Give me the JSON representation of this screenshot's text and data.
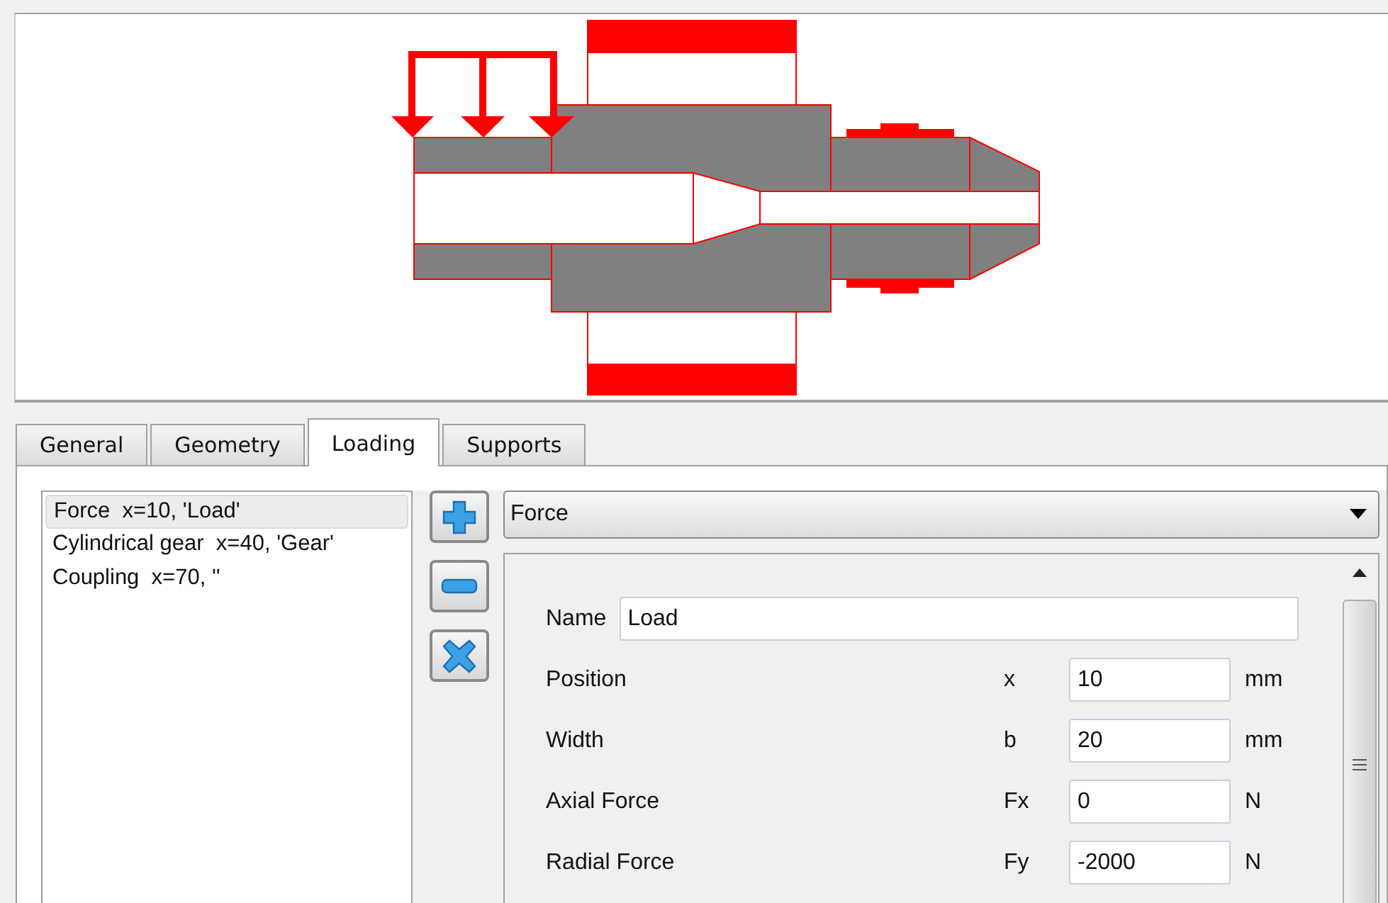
{
  "tabs": [
    {
      "label": "General",
      "selected": false
    },
    {
      "label": "Geometry",
      "selected": false
    },
    {
      "label": "Loading",
      "selected": true
    },
    {
      "label": "Supports",
      "selected": false
    }
  ],
  "elements": [
    {
      "label": "Force  x=10, 'Load'",
      "selected": true
    },
    {
      "label": "Cylindrical gear  x=40, 'Gear'",
      "selected": false
    },
    {
      "label": "Coupling  x=70, ''",
      "selected": false
    }
  ],
  "type_select": {
    "value": "Force"
  },
  "name_field": {
    "label": "Name",
    "value": "Load"
  },
  "properties": [
    {
      "label": "Position",
      "symbol": "x",
      "value": "10",
      "unit": "mm"
    },
    {
      "label": "Width",
      "symbol": "b",
      "value": "20",
      "unit": "mm"
    },
    {
      "label": "Axial Force",
      "symbol": "Fx",
      "value": "0",
      "unit": "N"
    },
    {
      "label": "Radial Force",
      "symbol": "Fy",
      "value": "-2000",
      "unit": "N"
    }
  ]
}
